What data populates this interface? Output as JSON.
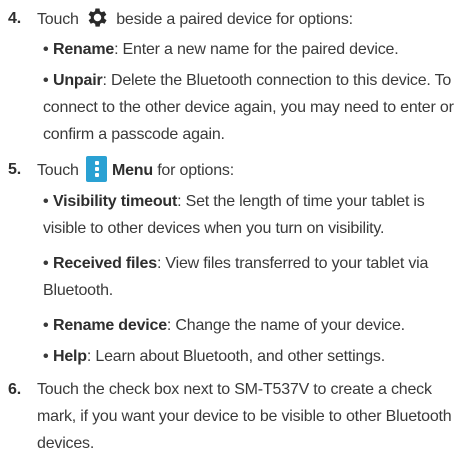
{
  "steps": [
    {
      "number": "4.",
      "before_icon": "Touch",
      "icon": "gear-icon",
      "after_icon": "beside a paired device for options:",
      "bullets": [
        {
          "term": "Rename",
          "desc": ": Enter a new name for the paired device."
        },
        {
          "term": "Unpair",
          "desc": ": Delete the Bluetooth connection to this device. To connect to the other device again, you may need to enter or confirm a passcode again."
        }
      ]
    },
    {
      "number": "5.",
      "before_icon": "Touch",
      "icon": "menu-icon",
      "icon_color": "#2aa1d3",
      "after_icon_bold": "Menu",
      "after_icon": "for options:",
      "bullets": [
        {
          "term": "Visibility timeout",
          "desc": ": Set the length of time your tablet is visible to other devices when you turn on visibility."
        },
        {
          "term": "Received files",
          "desc": ": View files transferred to your tablet via Bluetooth."
        },
        {
          "term": "Rename device",
          "desc": ": Change the name of your device."
        },
        {
          "term": "Help",
          "desc": ": Learn about Bluetooth, and other settings."
        }
      ]
    },
    {
      "number": "6.",
      "text": "Touch the check box next to SM-T537V to create a check mark, if you want your device to be visible to other Bluetooth devices."
    }
  ],
  "bullet_char": "•"
}
